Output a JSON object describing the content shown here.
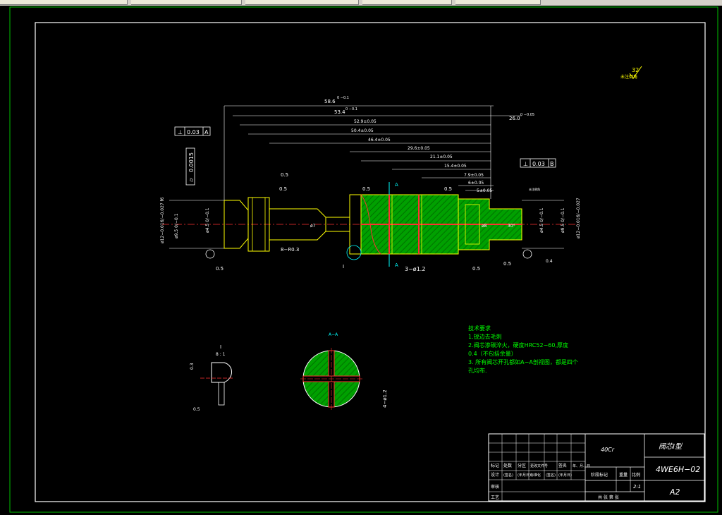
{
  "colors": {
    "background": "#000000",
    "frame": "#ffffff",
    "outline": "#ffff00",
    "section_fill": "#00a000",
    "hatch": "#ff3030",
    "center_line": "#ff3030",
    "section_arrow": "#00ffff",
    "border_green": "#00c000"
  },
  "roughness": "32",
  "dims": {
    "d1": "58.6",
    "d1t": "0 −0.1",
    "d2": "53.4",
    "d2t": "0 −0.1",
    "d3": "52.9±0.05",
    "d4": "50.4±0.05",
    "d5": "46.4±0.05",
    "d6": "29.6±0.05",
    "d7": "21.1±0.05",
    "d8": "15.4±0.05",
    "d9": "7.9±0.05",
    "d10": "6±0.05",
    "d11": "5±0.05",
    "d12": "26.0",
    "d12t": "0 −0.05",
    "s1": "0.5",
    "s2": "0.5",
    "s3": "0.5",
    "s4": "0.5",
    "s5": "0.5",
    "s6": "0.5",
    "s7": "0.5",
    "r": "8−R0.3",
    "holes": "3−ø1.2",
    "dia_left": "ø12−0.016/−0.027 f6",
    "dia_right": "ø12−0.016/−0.027",
    "d95": "ø9.5 0/−0.1",
    "d45": "ø4.5 0/−0.1",
    "d7c": "ø7",
    "d8c": "ø8",
    "d30": "30°",
    "d05a": "0.5",
    "d04": "0.4",
    "note_small": "未注倒角"
  },
  "tolerances": {
    "gdt1_sym": "⊥",
    "gdt1_val": "0.03",
    "gdt1_ref": "A",
    "gdt2_sym": "⊥",
    "gdt2_val": "0.03",
    "gdt2_ref": "B",
    "gdt3_sym": "⌭",
    "gdt3_val": "0.0015"
  },
  "labels": {
    "A1": "A",
    "A2": "A",
    "section_title": "A−A",
    "detail_ref": "I",
    "detail_title": "I",
    "detail_scale": "8 : 1",
    "detail_dim1": "0.3",
    "detail_dim1t": "+0.1 0",
    "detail_dim2": "0.5",
    "detail_dim2t": "+0.1 0",
    "sec_dim": "4−ø1.2"
  },
  "tech": {
    "title": "技术要求",
    "line1": "1.锐边去毛刺",
    "line2": "2.阀芯渗碳淬火，硬度HRC52−60,厚度",
    "line3": "0.4（不包括余量）",
    "line4": "3. 所有阀芯开孔都如A−A剖视图，都是四个",
    "line5": "孔均布."
  },
  "title_block": {
    "material": "40Cr",
    "part_name": "阀芯I型",
    "drawing_no": "4WE6H−02",
    "scale": "2:1",
    "sheet": "A2",
    "h1": "标记",
    "h2": "处数",
    "h3": "分区",
    "h4": "更改文件号",
    "h5": "签名",
    "h6": "年、月、日",
    "r1": "设计",
    "r2": "(签名)",
    "r3": "(年月日)",
    "r4": "标准化",
    "r5": "(签名)",
    "r6": "(年月日)",
    "c1": "阶段标记",
    "c2": "重量",
    "c3": "比例",
    "b1": "审核",
    "b2": "工艺",
    "b3": "共 张 第 张"
  }
}
